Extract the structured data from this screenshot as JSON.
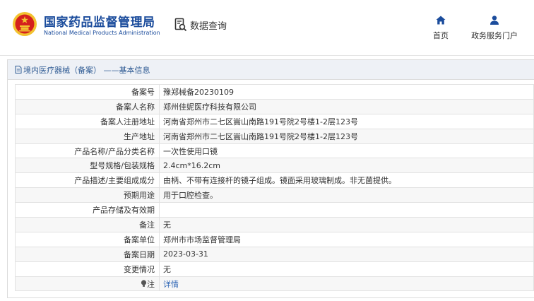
{
  "header": {
    "org_name_cn": "国家药品监督管理局",
    "org_name_en": "National Medical Products Administration",
    "query_label": "数据查询",
    "nav": [
      {
        "label": "首页",
        "icon": "home-icon"
      },
      {
        "label": "政务服务门户",
        "icon": "user-icon"
      }
    ]
  },
  "panel": {
    "title": "境内医疗器械（备案） ——基本信息",
    "title_icon": "document-icon"
  },
  "record": {
    "rows": [
      {
        "label": "备案号",
        "value": "豫郑械备20230109"
      },
      {
        "label": "备案人名称",
        "value": "郑州佳妮医疗科技有限公司"
      },
      {
        "label": "备案人注册地址",
        "value": "河南省郑州市二七区嵩山南路191号院2号楼1-2层123号"
      },
      {
        "label": "生产地址",
        "value": "河南省郑州市二七区嵩山南路191号院2号楼1-2层123号"
      },
      {
        "label": "产品名称/产品分类名称",
        "value": "一次性使用口镜"
      },
      {
        "label": "型号规格/包装规格",
        "value": "2.4cm*16.2cm"
      },
      {
        "label": "产品描述/主要组成成分",
        "value": "由柄、不带有连接杆的镜子组成。镜面采用玻璃制成。非无菌提供。"
      },
      {
        "label": "预期用途",
        "value": "用于口腔检查。"
      },
      {
        "label": "产品存储及有效期",
        "value": ""
      },
      {
        "label": "备注",
        "value": "无"
      },
      {
        "label": "备案单位",
        "value": "郑州市市场监督管理局"
      },
      {
        "label": "备案日期",
        "value": "2023-03-31"
      },
      {
        "label": "变更情况",
        "value": "无"
      }
    ],
    "note_label": "注",
    "note_icon": "bulb-icon",
    "note_link": "详情"
  },
  "colors": {
    "brand_blue": "#1b4c9c",
    "link_blue": "#2c64b4",
    "title_bg": "#eef1f6",
    "emblem_red": "#d4201e",
    "emblem_gold": "#f2c230"
  }
}
